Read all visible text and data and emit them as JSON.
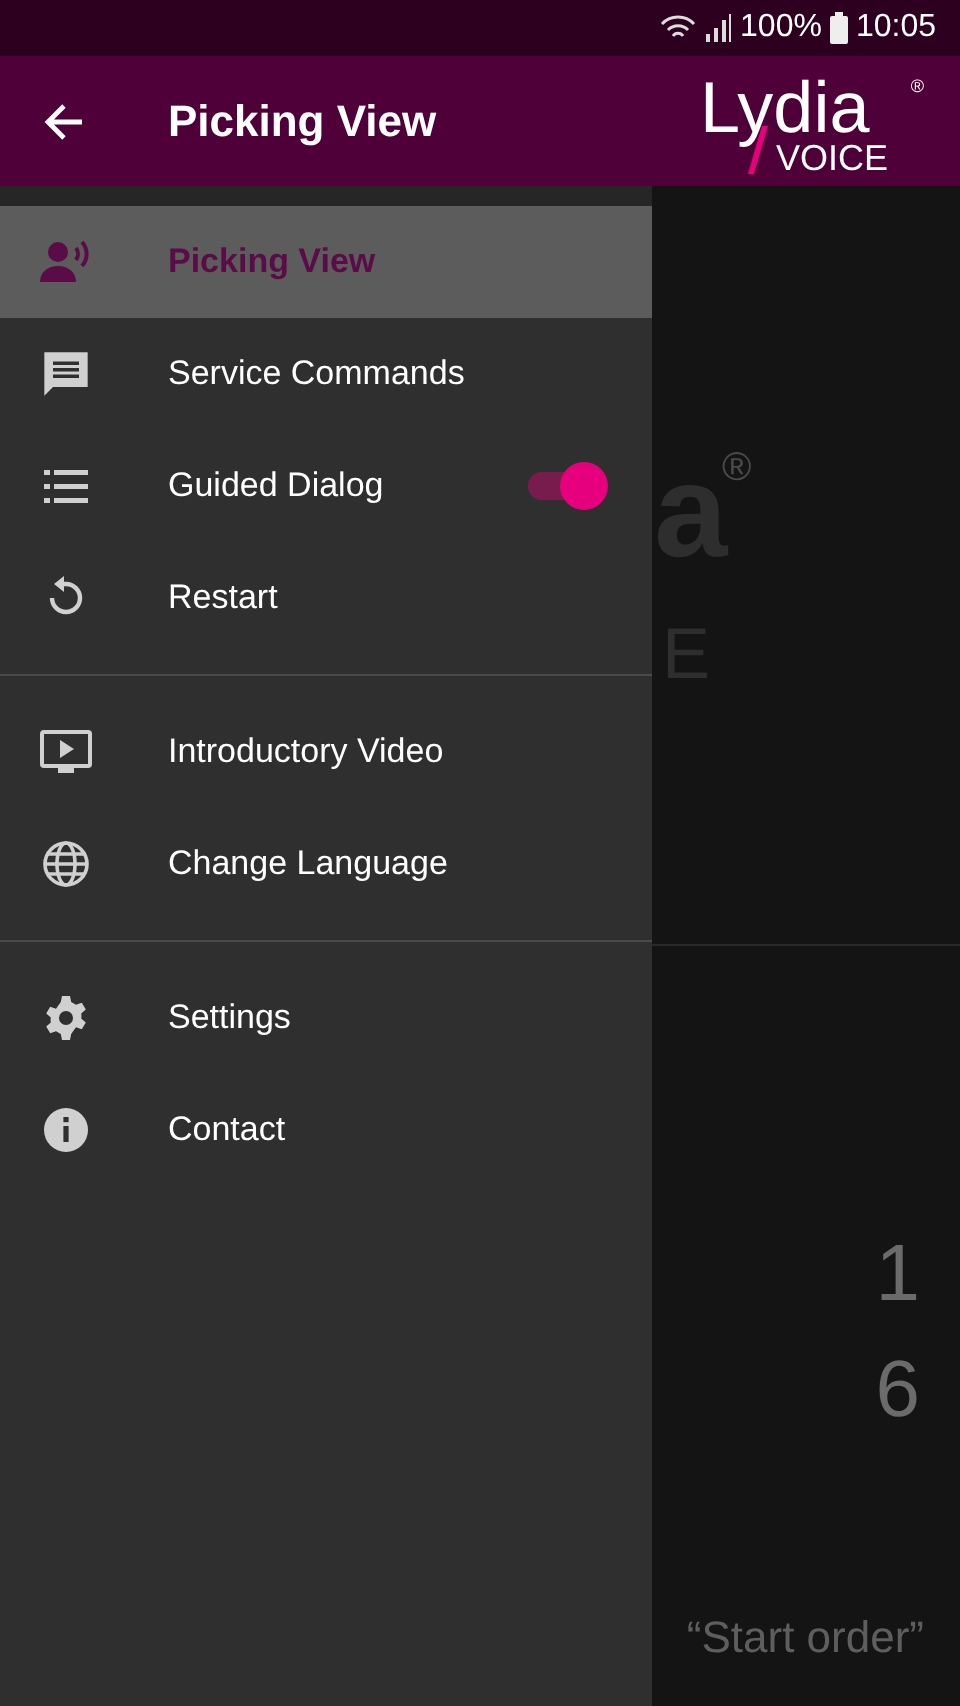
{
  "status_bar": {
    "battery": "100%",
    "time": "10:05"
  },
  "app_bar": {
    "title": "Picking View",
    "logo": {
      "word": "Lydia",
      "mark": "®",
      "sub": "VOICE"
    }
  },
  "drawer": {
    "groups": [
      {
        "items": [
          {
            "label": "Picking View",
            "selected": true
          },
          {
            "label": "Service Commands",
            "selected": false
          },
          {
            "label": "Guided Dialog",
            "selected": false,
            "toggle": {
              "on": true
            }
          },
          {
            "label": "Restart",
            "selected": false
          }
        ]
      },
      {
        "items": [
          {
            "label": "Introductory Video",
            "selected": false
          },
          {
            "label": "Change Language",
            "selected": false
          }
        ]
      },
      {
        "items": [
          {
            "label": "Settings",
            "selected": false
          },
          {
            "label": "Contact",
            "selected": false
          }
        ]
      }
    ]
  },
  "background": {
    "logo_fragment": "a",
    "logo_mark": "®",
    "logo_sub_fragment": "E",
    "quantities": [
      "1",
      "6"
    ],
    "prompt": "“Start order”"
  }
}
